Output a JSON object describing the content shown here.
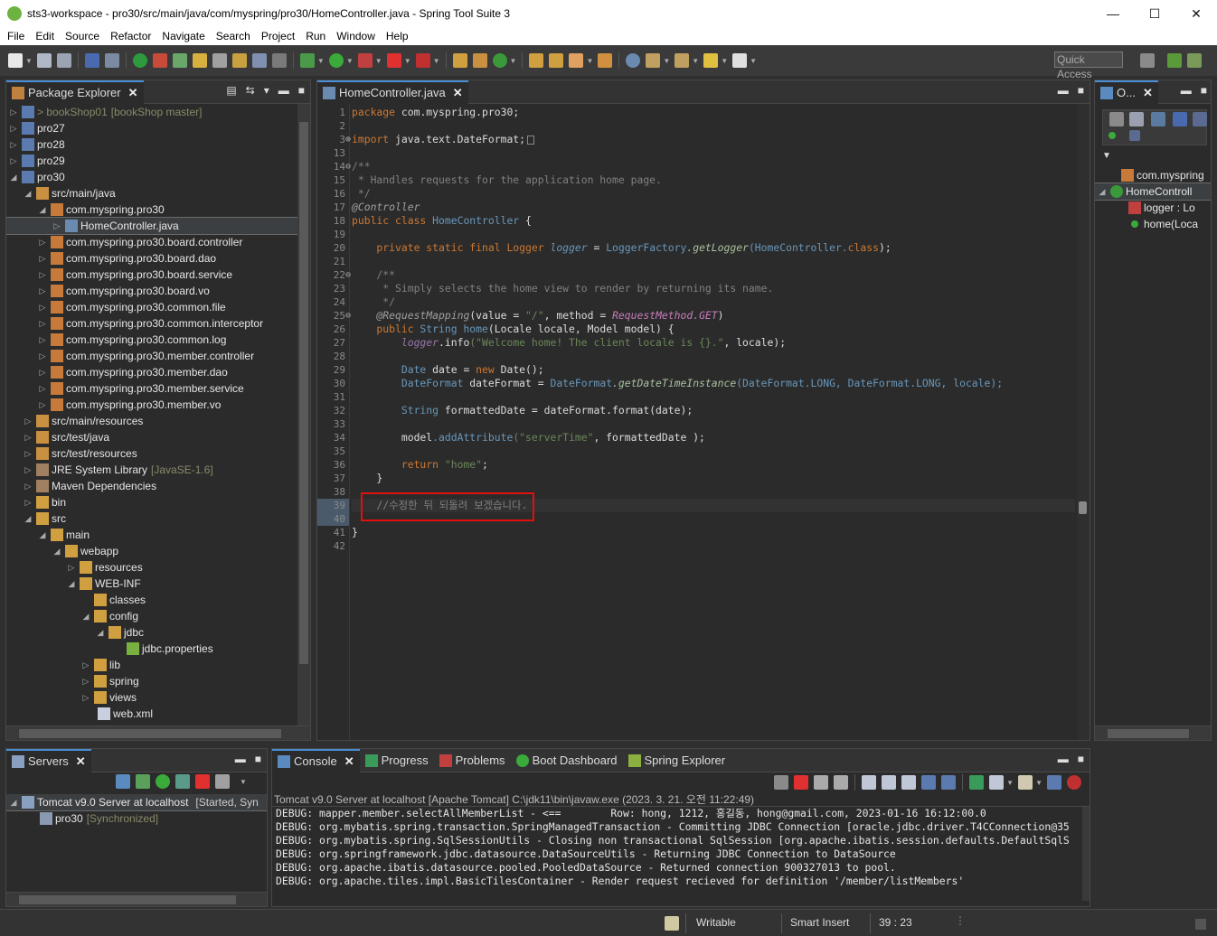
{
  "window": {
    "title": "sts3-workspace - pro30/src/main/java/com/myspring/pro30/HomeController.java - Spring Tool Suite 3",
    "minimize": "—",
    "maximize": "☐",
    "close": "✕"
  },
  "menu": [
    "File",
    "Edit",
    "Source",
    "Refactor",
    "Navigate",
    "Search",
    "Project",
    "Run",
    "Window",
    "Help"
  ],
  "toolbar": {
    "quick_access": "Quick Access"
  },
  "package_explorer": {
    "tab_label": "Package Explorer",
    "rows": [
      {
        "label": "> bookShop01",
        "extra": "[bookShop master]"
      },
      {
        "label": "pro27",
        "extra": ""
      },
      {
        "label": "pro28",
        "extra": ""
      },
      {
        "label": "pro29",
        "extra": ""
      },
      {
        "label": "pro30",
        "extra": ""
      },
      {
        "label": "src/main/java",
        "extra": ""
      },
      {
        "label": "com.myspring.pro30",
        "extra": ""
      },
      {
        "label": "HomeController.java",
        "extra": ""
      },
      {
        "label": "com.myspring.pro30.board.controller",
        "extra": ""
      },
      {
        "label": "com.myspring.pro30.board.dao",
        "extra": ""
      },
      {
        "label": "com.myspring.pro30.board.service",
        "extra": ""
      },
      {
        "label": "com.myspring.pro30.board.vo",
        "extra": ""
      },
      {
        "label": "com.myspring.pro30.common.file",
        "extra": ""
      },
      {
        "label": "com.myspring.pro30.common.interceptor",
        "extra": ""
      },
      {
        "label": "com.myspring.pro30.common.log",
        "extra": ""
      },
      {
        "label": "com.myspring.pro30.member.controller",
        "extra": ""
      },
      {
        "label": "com.myspring.pro30.member.dao",
        "extra": ""
      },
      {
        "label": "com.myspring.pro30.member.service",
        "extra": ""
      },
      {
        "label": "com.myspring.pro30.member.vo",
        "extra": ""
      },
      {
        "label": "src/main/resources",
        "extra": ""
      },
      {
        "label": "src/test/java",
        "extra": ""
      },
      {
        "label": "src/test/resources",
        "extra": ""
      },
      {
        "label": "JRE System Library",
        "extra": "[JavaSE-1.6]"
      },
      {
        "label": "Maven Dependencies",
        "extra": ""
      },
      {
        "label": "bin",
        "extra": ""
      },
      {
        "label": "src",
        "extra": ""
      },
      {
        "label": "main",
        "extra": ""
      },
      {
        "label": "webapp",
        "extra": ""
      },
      {
        "label": "resources",
        "extra": ""
      },
      {
        "label": "WEB-INF",
        "extra": ""
      },
      {
        "label": "classes",
        "extra": ""
      },
      {
        "label": "config",
        "extra": ""
      },
      {
        "label": "jdbc",
        "extra": ""
      },
      {
        "label": "jdbc.properties",
        "extra": ""
      },
      {
        "label": "lib",
        "extra": ""
      },
      {
        "label": "spring",
        "extra": ""
      },
      {
        "label": "views",
        "extra": ""
      },
      {
        "label": "web.xml",
        "extra": ""
      }
    ]
  },
  "editor": {
    "tab_label": "HomeController.java",
    "line_numbers": [
      "1",
      "2",
      "3",
      "13",
      "14",
      "15",
      "16",
      "17",
      "18",
      "19",
      "20",
      "21",
      "22",
      "23",
      "24",
      "25",
      "26",
      "27",
      "28",
      "29",
      "30",
      "31",
      "32",
      "33",
      "34",
      "35",
      "36",
      "37",
      "38",
      "39",
      "40",
      "41",
      "42"
    ],
    "lines": {
      "l1_kw": "package",
      "l1_rest": " com.myspring.pro30;",
      "l3_kw": "import",
      "l3_rest": " java.text.DateFormat;",
      "l14": "/**",
      "l15": " * Handles requests for the application home page.",
      "l16": " */",
      "l17": "@Controller",
      "l18_kw": "public class",
      "l18_name": " HomeController",
      "l18_rest": " {",
      "l20_kw": "    private static final",
      "l20_type": " Logger",
      "l20_var": " logger",
      "l20_eq": " = ",
      "l20_fac": "LoggerFactory",
      "l20_m": ".getLogger",
      "l20_args": "(HomeController.",
      "l20_cls": "class",
      "l20_end": ");",
      "l22": "    /**",
      "l23": "     * Simply selects the home view to render by returning its name.",
      "l24": "     */",
      "l25_an": "    @RequestMapping",
      "l25_a": "(value = ",
      "l25_s": "\"/\"",
      "l25_b": ", method = ",
      "l25_c": "RequestMethod.GET",
      "l25_d": ")",
      "l26_kw": "    public",
      "l26_t": " String",
      "l26_m": " home",
      "l26_rest": "(Locale locale, Model model) {",
      "l27_v": "        logger",
      "l27_m": ".info",
      "l27_s": "(\"Welcome home! The client locale is {}.\"",
      "l27_rest": ", locale);",
      "l29_t": "        Date",
      "l29_v": " date",
      "l29_eq": " = ",
      "l29_kw": "new",
      "l29_rest": " Date();",
      "l30_t": "        DateFormat",
      "l30_v": " dateFormat",
      "l30_eq": " = ",
      "l30_cls": "DateFormat",
      "l30_m": ".getDateTimeInstance",
      "l30_rest": "(DateFormat.LONG, DateFormat.LONG, locale);",
      "l32_t": "        String",
      "l32_v": " formattedDate",
      "l32_eq": " = ",
      "l32_rest": "dateFormat.format(date);",
      "l34_v": "        model",
      "l34_m": ".addAttribute",
      "l34_s": "(\"serverTime\"",
      "l34_rest": ", formattedDate );",
      "l36_kw": "        return",
      "l36_s": " \"home\"",
      "l36_rest": ";",
      "l37": "    }",
      "l39": "    //수정한 뒤 되돌려 보겠습니다.",
      "l41": "}"
    }
  },
  "outline": {
    "tab_label": "O...",
    "rows": [
      {
        "label": "com.myspring"
      },
      {
        "label": "HomeControll"
      },
      {
        "label": "logger : Lo"
      },
      {
        "label": "home(Loca"
      }
    ]
  },
  "servers": {
    "tab_label": "Servers",
    "rows": [
      {
        "label": "Tomcat v9.0 Server at localhost",
        "extra": "[Started, Syn"
      },
      {
        "label": "pro30",
        "extra": "[Synchronized]"
      }
    ]
  },
  "console": {
    "tabs": [
      "Console",
      "Progress",
      "Problems",
      "Boot Dashboard",
      "Spring Explorer"
    ],
    "header": "Tomcat v9.0 Server at localhost [Apache Tomcat] C:\\jdk11\\bin\\javaw.exe (2023. 3. 21. 오전 11:22:49)",
    "lines": [
      "DEBUG: mapper.member.selectAllMemberList - <==        Row: hong, 1212, 홍길동, hong@gmail.com, 2023-01-16 16:12:00.0",
      "DEBUG: org.mybatis.spring.transaction.SpringManagedTransaction - Committing JDBC Connection [oracle.jdbc.driver.T4CConnection@35",
      "DEBUG: org.mybatis.spring.SqlSessionUtils - Closing non transactional SqlSession [org.apache.ibatis.session.defaults.DefaultSqlS",
      "DEBUG: org.springframework.jdbc.datasource.DataSourceUtils - Returning JDBC Connection to DataSource",
      "DEBUG: org.apache.ibatis.datasource.pooled.PooledDataSource - Returned connection 900327013 to pool.",
      "DEBUG: org.apache.tiles.impl.BasicTilesContainer - Render request recieved for definition '/member/listMembers'"
    ]
  },
  "status": {
    "writable": "Writable",
    "insert_mode": "Smart Insert",
    "position": "39 : 23"
  },
  "colors": {
    "accent": "#4a8fd6",
    "highlight_box": "#e01010",
    "keyword": "#cc7832",
    "string": "#6a8759",
    "type": "#6897bb"
  }
}
